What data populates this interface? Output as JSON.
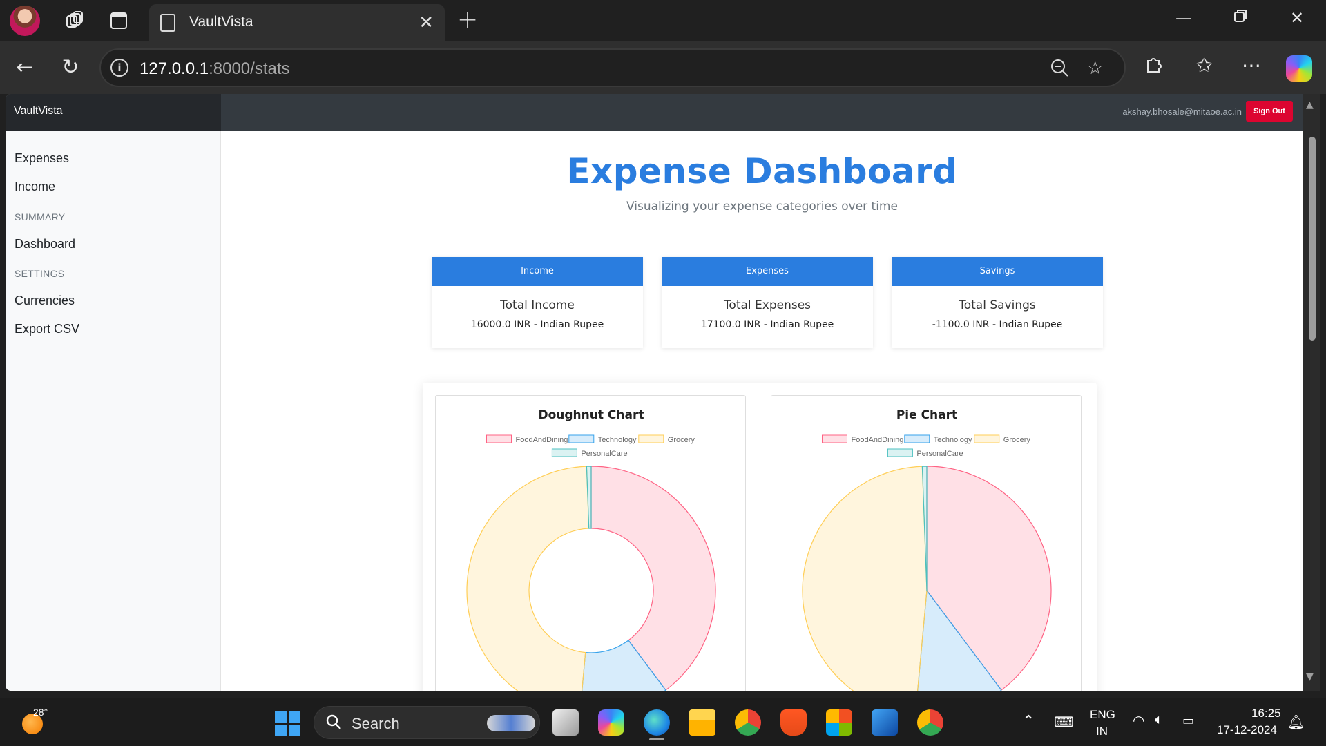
{
  "browser": {
    "tab_title": "VaultVista",
    "url_host": "127.0.0.1",
    "url_rest": ":8000/stats"
  },
  "app": {
    "brand": "VaultVista",
    "user_email": "akshay.bhosale@mitaoe.ac.in",
    "signout_label": "Sign Out"
  },
  "sidebar": {
    "links_top": [
      "Expenses",
      "Income"
    ],
    "summary_heading": "SUMMARY",
    "summary_links": [
      "Dashboard"
    ],
    "settings_heading": "SETTINGS",
    "settings_links": [
      "Currencies",
      "Export CSV"
    ]
  },
  "dashboard": {
    "title": "Expense Dashboard",
    "subtitle": "Visualizing your expense categories over time",
    "cards": [
      {
        "header": "Income",
        "title": "Total Income",
        "value": "16000.0 INR - Indian Rupee"
      },
      {
        "header": "Expenses",
        "title": "Total Expenses",
        "value": "17100.0 INR - Indian Rupee"
      },
      {
        "header": "Savings",
        "title": "Total Savings",
        "value": "-1100.0 INR - Indian Rupee"
      }
    ]
  },
  "chart_data": [
    {
      "type": "doughnut",
      "title": "Doughnut Chart",
      "legend_position": "top",
      "categories": [
        "FoodAndDining",
        "Technology",
        "Grocery",
        "PersonalCare"
      ],
      "values": [
        6800,
        2000,
        8200,
        100
      ],
      "colors": [
        "#ff6384",
        "#36a2eb",
        "#ffce56",
        "#4bc0c0"
      ]
    },
    {
      "type": "pie",
      "title": "Pie Chart",
      "legend_position": "top",
      "categories": [
        "FoodAndDining",
        "Technology",
        "Grocery",
        "PersonalCare"
      ],
      "values": [
        6800,
        2000,
        8200,
        100
      ],
      "colors": [
        "#ff6384",
        "#36a2eb",
        "#ffce56",
        "#4bc0c0"
      ]
    }
  ],
  "taskbar": {
    "temperature": "28°",
    "search_label": "Search",
    "lang_1": "ENG",
    "lang_2": "IN",
    "time": "16:25",
    "date": "17-12-2024"
  }
}
